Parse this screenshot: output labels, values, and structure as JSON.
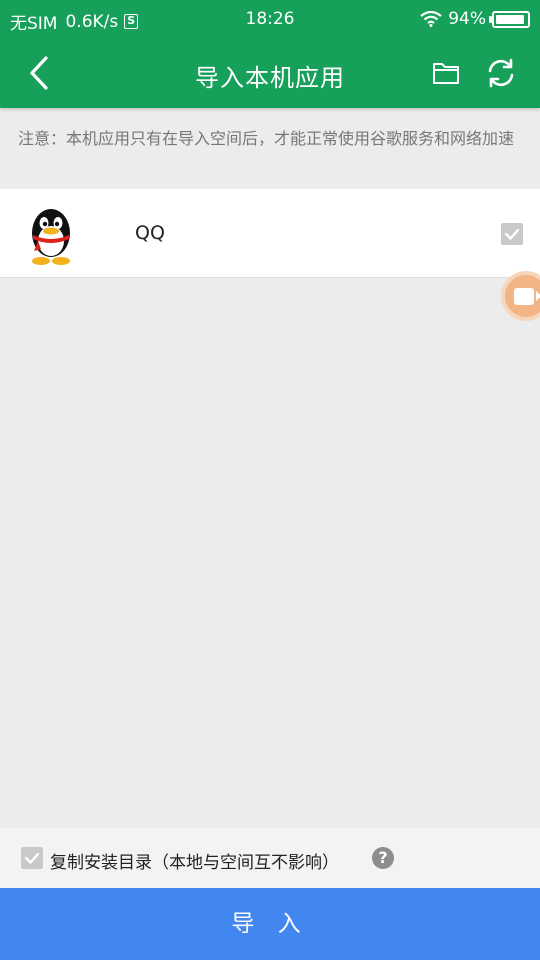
{
  "status_bar": {
    "carrier": "无SIM",
    "speed": "0.6K/s",
    "time": "18:26",
    "battery": "94%",
    "icons": [
      "sim-s-icon",
      "wifi-icon",
      "battery-icon"
    ]
  },
  "title_bar": {
    "title": "导入本机应用",
    "icons": [
      "back-arrow-icon",
      "folder-icon",
      "refresh-icon"
    ],
    "color": "#17a05a"
  },
  "notice": "注意：本机应用只有在导入空间后，才能正常使用谷歌服务和网络加速",
  "apps": [
    {
      "name": "QQ",
      "icon": "qq-penguin-icon",
      "checked": true
    }
  ],
  "bottom": {
    "copy_dir_label": "复制安装目录（本地与空间互不影响）",
    "copy_dir_checked": true,
    "help": "?",
    "import_label": "导 入",
    "import_color": "#4286f0"
  },
  "float_button_icon": "video-camera-icon"
}
